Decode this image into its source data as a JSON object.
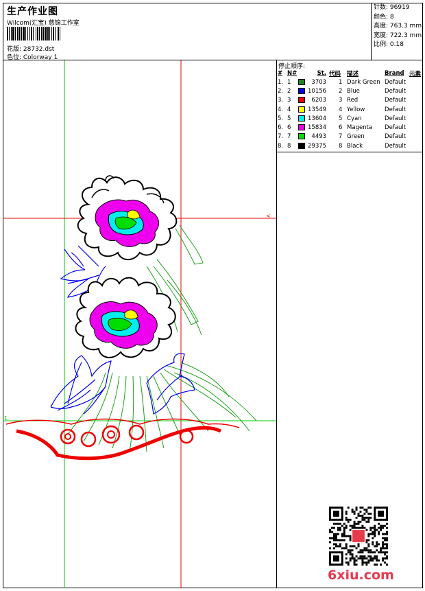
{
  "header": {
    "title": "生产作业图",
    "studio": "Wilcom(汇宝) 慈锦工作室",
    "design_label": "花版: 28732.dst",
    "colorway_label": "色位: Colorway 1"
  },
  "stats": [
    {
      "label": "针数",
      "value": "96919"
    },
    {
      "label": "颜色",
      "value": "8"
    },
    {
      "label": "高度",
      "value": "763.3 mm"
    },
    {
      "label": "宽度",
      "value": "722.3 mm"
    },
    {
      "label": "比例",
      "value": "0.18"
    }
  ],
  "stop_sequence": {
    "title": "停止顺序:",
    "headers": {
      "num": "#",
      "n": "N#",
      "st": "St.",
      "code": "代码",
      "desc": "描述",
      "brand": "Brand",
      "element": "元素"
    },
    "rows": [
      {
        "num": "1.",
        "n": "1",
        "color": "#1a8a1a",
        "st": "3703",
        "code": "1",
        "desc": "Dark Green",
        "brand": "Default"
      },
      {
        "num": "2.",
        "n": "2",
        "color": "#0000ee",
        "st": "10156",
        "code": "2",
        "desc": "Blue",
        "brand": "Default"
      },
      {
        "num": "3.",
        "n": "3",
        "color": "#ee0000",
        "st": "6203",
        "code": "3",
        "desc": "Red",
        "brand": "Default"
      },
      {
        "num": "4.",
        "n": "4",
        "color": "#ffff00",
        "st": "13549",
        "code": "4",
        "desc": "Yellow",
        "brand": "Default"
      },
      {
        "num": "5.",
        "n": "5",
        "color": "#00eeee",
        "st": "13604",
        "code": "5",
        "desc": "Cyan",
        "brand": "Default"
      },
      {
        "num": "6.",
        "n": "6",
        "color": "#ee00ee",
        "st": "15834",
        "code": "6",
        "desc": "Magenta",
        "brand": "Default"
      },
      {
        "num": "7.",
        "n": "7",
        "color": "#00dd00",
        "st": "4493",
        "code": "7",
        "desc": "Green",
        "brand": "Default"
      },
      {
        "num": "8.",
        "n": "8",
        "color": "#000000",
        "st": "29375",
        "code": "8",
        "desc": "Black",
        "brand": "Default"
      }
    ]
  },
  "watermark": "6xiu.com",
  "colors": {
    "guide_green": "#00cc00",
    "guide_red": "#ee0000",
    "watermark": "#e63a4d"
  }
}
